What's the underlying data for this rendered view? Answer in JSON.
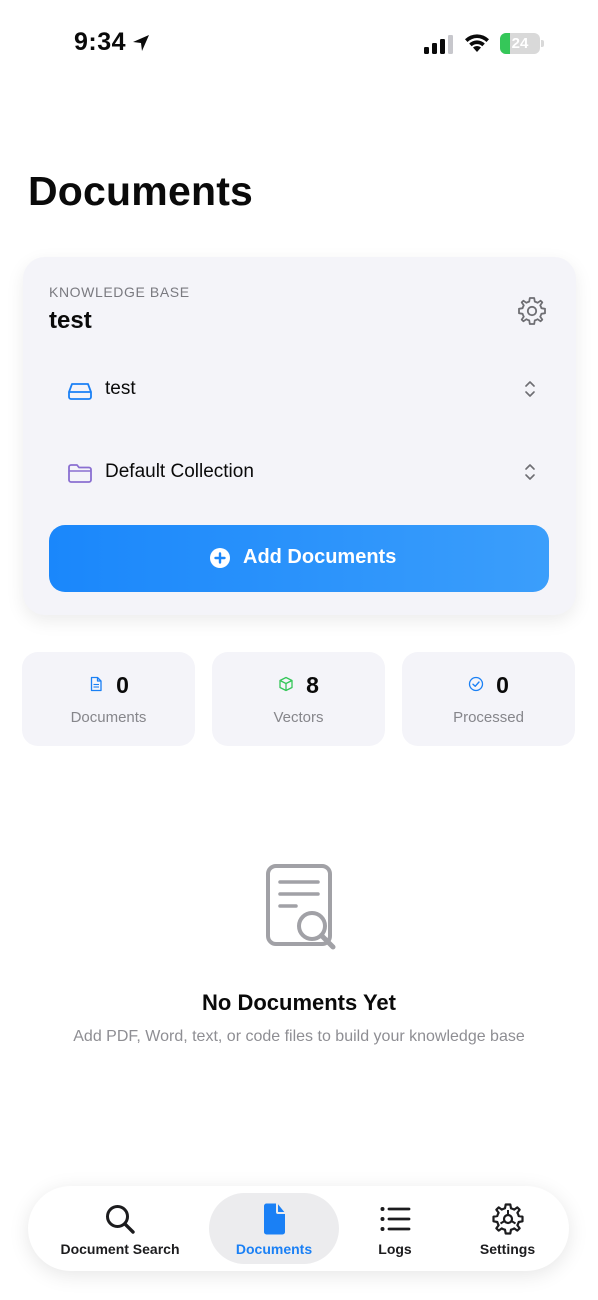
{
  "status_bar": {
    "time": "9:34",
    "battery_level": "24",
    "battery_fraction": 0.24,
    "battery_color": "#35c759"
  },
  "page": {
    "title": "Documents"
  },
  "knowledge_base": {
    "eyebrow": "KNOWLEDGE BASE",
    "name": "test",
    "settings_icon": "gear-icon",
    "store_picker": {
      "icon": "hard-drive-icon",
      "label": "test"
    },
    "collection_picker": {
      "icon": "folder-icon",
      "label": "Default Collection"
    },
    "add_button": {
      "icon": "plus-circle-icon",
      "label": "Add Documents"
    }
  },
  "stats": [
    {
      "icon": "document-icon",
      "value": "0",
      "label": "Documents",
      "color": "#1a80f5"
    },
    {
      "icon": "cube-icon",
      "value": "8",
      "label": "Vectors",
      "color": "#35c759"
    },
    {
      "icon": "check-circle-icon",
      "value": "0",
      "label": "Processed",
      "color": "#1a80f5"
    }
  ],
  "empty_state": {
    "icon": "document-search-icon",
    "title": "No Documents Yet",
    "subtitle": "Add PDF, Word, text, or code files to build your knowledge base"
  },
  "tabs": [
    {
      "icon": "search-icon",
      "label": "Document Search",
      "active": false
    },
    {
      "icon": "document-icon",
      "label": "Documents",
      "active": true
    },
    {
      "icon": "list-icon",
      "label": "Logs",
      "active": false
    },
    {
      "icon": "gear-icon",
      "label": "Settings",
      "active": false
    }
  ],
  "colors": {
    "accent": "#1a80f5",
    "card_bg": "#f4f4f9",
    "secondary_text": "#8e8e93"
  }
}
